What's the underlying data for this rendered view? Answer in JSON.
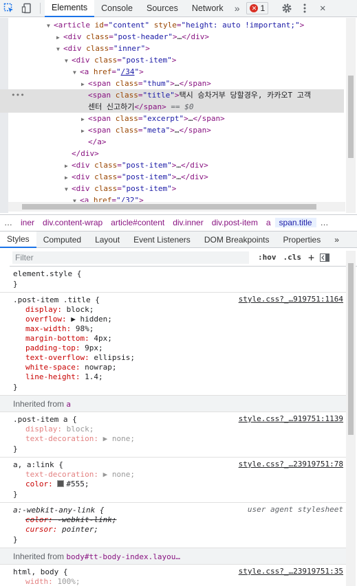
{
  "toolbar": {
    "tabs": [
      "Elements",
      "Console",
      "Sources",
      "Network"
    ],
    "more": "»",
    "error_count": "1"
  },
  "dom": [
    {
      "indent": 78,
      "tri": "▼",
      "html_open": "<article ",
      "attrs": [
        {
          "n": "id",
          "v": "\"content\""
        },
        {
          "n": "style",
          "v": "\"height: auto !important;\""
        }
      ],
      "close": ">"
    },
    {
      "indent": 92,
      "tri": "▶",
      "text": "<div class=\"post-header\">…</div>"
    },
    {
      "indent": 92,
      "tri": "▼",
      "text": "<div class=\"inner\">"
    },
    {
      "indent": 104,
      "tri": "▼",
      "text": "<div class=\"post-item\">"
    },
    {
      "indent": 116,
      "tri": "▼",
      "text": "<a href=\"/34\">"
    },
    {
      "indent": 128,
      "tri": "▶",
      "text": "<span class=\"thum\">…</span>"
    },
    {
      "indent": 128,
      "tri": "",
      "text": "<span class=\"title\">택시 승차거부 당할경우, 카카오T 고객",
      "sel": true
    },
    {
      "indent": 128,
      "tri": "",
      "text": "센터 신고하기</span> == $0",
      "sel": true
    },
    {
      "indent": 128,
      "tri": "▶",
      "text": "<span class=\"excerpt\">…</span>"
    },
    {
      "indent": 128,
      "tri": "▶",
      "text": "<span class=\"meta\">…</span>"
    },
    {
      "indent": 128,
      "tri": "",
      "text": "</a>"
    },
    {
      "indent": 104,
      "tri": "",
      "text": "</div>"
    },
    {
      "indent": 104,
      "tri": "▶",
      "text": "<div class=\"post-item\">…</div>"
    },
    {
      "indent": 104,
      "tri": "▶",
      "text": "<div class=\"post-item\">…</div>"
    },
    {
      "indent": 104,
      "tri": "▼",
      "text": "<div class=\"post-item\">"
    },
    {
      "indent": 116,
      "tri": "▼",
      "text": "<a href=\"/32\">"
    }
  ],
  "breadcrumbs": [
    "…",
    "iner",
    "div.content-wrap",
    "article#content",
    "div.inner",
    "div.post-item",
    "a",
    "span.title",
    "…"
  ],
  "subtabs": [
    "Styles",
    "Computed",
    "Layout",
    "Event Listeners",
    "DOM Breakpoints",
    "Properties",
    "»"
  ],
  "filter": {
    "placeholder": "Filter",
    "hov": ":hov",
    "cls": ".cls",
    "plus": "+"
  },
  "rules": {
    "element_style": {
      "selector": "element.style {",
      "close": "}"
    },
    "post_item_title": {
      "selector": ".post-item .title {",
      "source": "style.css?_…919751:1164",
      "props": [
        {
          "n": "display",
          "v": "block;"
        },
        {
          "n": "overflow",
          "v": "▶ hidden;"
        },
        {
          "n": "max-width",
          "v": "98%;"
        },
        {
          "n": "margin-bottom",
          "v": "4px;"
        },
        {
          "n": "padding-top",
          "v": "9px;"
        },
        {
          "n": "text-overflow",
          "v": "ellipsis;"
        },
        {
          "n": "white-space",
          "v": "nowrap;"
        },
        {
          "n": "line-height",
          "v": "1.4;"
        }
      ],
      "close": "}"
    },
    "inherited_a": {
      "label": "Inherited from",
      "tag": "a"
    },
    "post_item_a": {
      "selector": ".post-item a {",
      "source": "style.css?_…919751:1139",
      "props": [
        {
          "n": "display",
          "v": "block;"
        },
        {
          "n": "text-decoration",
          "v": "▶ none;"
        }
      ],
      "close": "}"
    },
    "a_link": {
      "selector": "a, a:link {",
      "source": "style.css?_…23919751:78",
      "props": [
        {
          "n": "text-decoration",
          "v": "▶ none;"
        },
        {
          "n": "color",
          "v": "#555;"
        }
      ],
      "close": "}"
    },
    "webkit_any_link": {
      "selector": "a:-webkit-any-link {",
      "source": "user agent stylesheet",
      "props": [
        {
          "n": "color",
          "v": "-webkit-link;"
        },
        {
          "n": "cursor",
          "v": "pointer;"
        }
      ],
      "close": "}"
    },
    "inherited_body": {
      "label": "Inherited from",
      "tag": "body#tt-body-index.layou…"
    },
    "html_body": {
      "selector": "html, body {",
      "source": "style.css?_…23919751:35",
      "props": [
        {
          "n": "width",
          "v": "100%;"
        }
      ]
    }
  },
  "colors": {
    "accent": "#1a73e8",
    "tag": "#881280",
    "prop": "#c80000",
    "swatch": "#555555"
  }
}
